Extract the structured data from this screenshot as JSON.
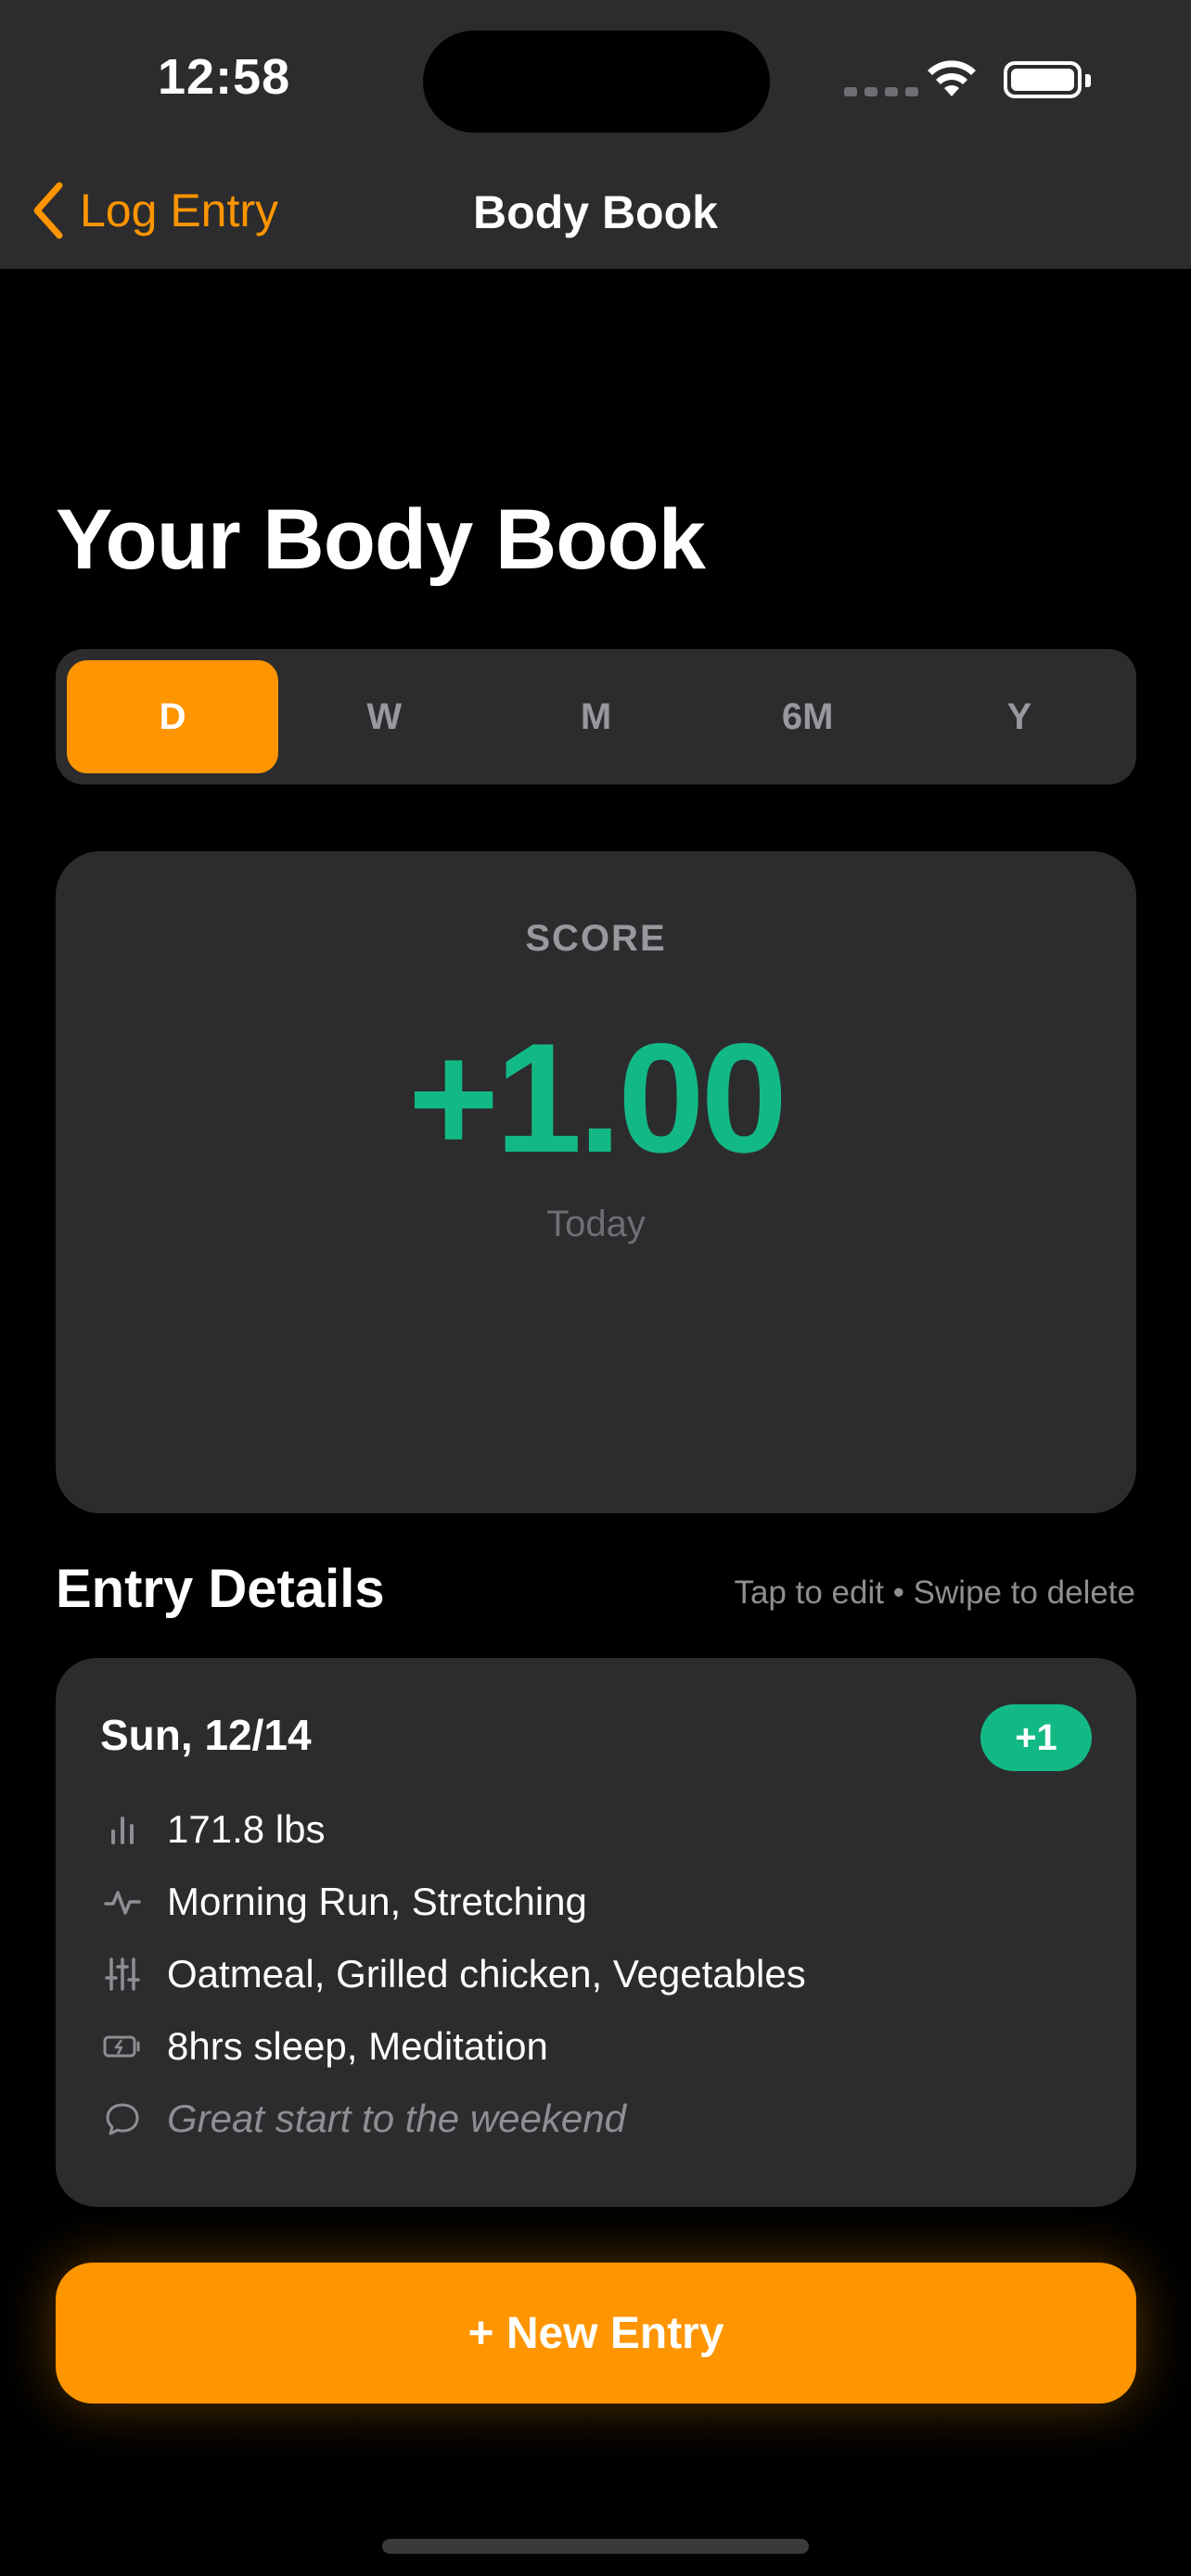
{
  "status_bar": {
    "time": "12:58"
  },
  "nav": {
    "back_label": "Log Entry",
    "title": "Body Book"
  },
  "page": {
    "title": "Your Body Book"
  },
  "range_tabs": {
    "items": [
      "D",
      "W",
      "M",
      "6M",
      "Y"
    ],
    "selected": "D"
  },
  "score": {
    "label": "SCORE",
    "value": "+1.00",
    "period": "Today",
    "color": "#13b984"
  },
  "entries": {
    "title": "Entry Details",
    "hint": "Tap to edit • Swipe to delete",
    "items": [
      {
        "date": "Sun, 12/14",
        "badge": "+1",
        "weight": "171.8 lbs",
        "activity": "Morning Run, Stretching",
        "food": "Oatmeal, Grilled chicken, Vegetables",
        "recovery": "8hrs sleep, Meditation",
        "note": "Great start to the weekend"
      }
    ]
  },
  "actions": {
    "new_entry_label": "+ New Entry"
  },
  "colors": {
    "accent": "#ff9500",
    "positive": "#13b984",
    "card": "#2c2c2e",
    "background": "#000000"
  },
  "icons": [
    "chevron-left-icon",
    "wifi-icon",
    "battery-icon",
    "chart-bars-icon",
    "pulse-icon",
    "sliders-icon",
    "battery-charge-icon",
    "speech-bubble-icon"
  ]
}
